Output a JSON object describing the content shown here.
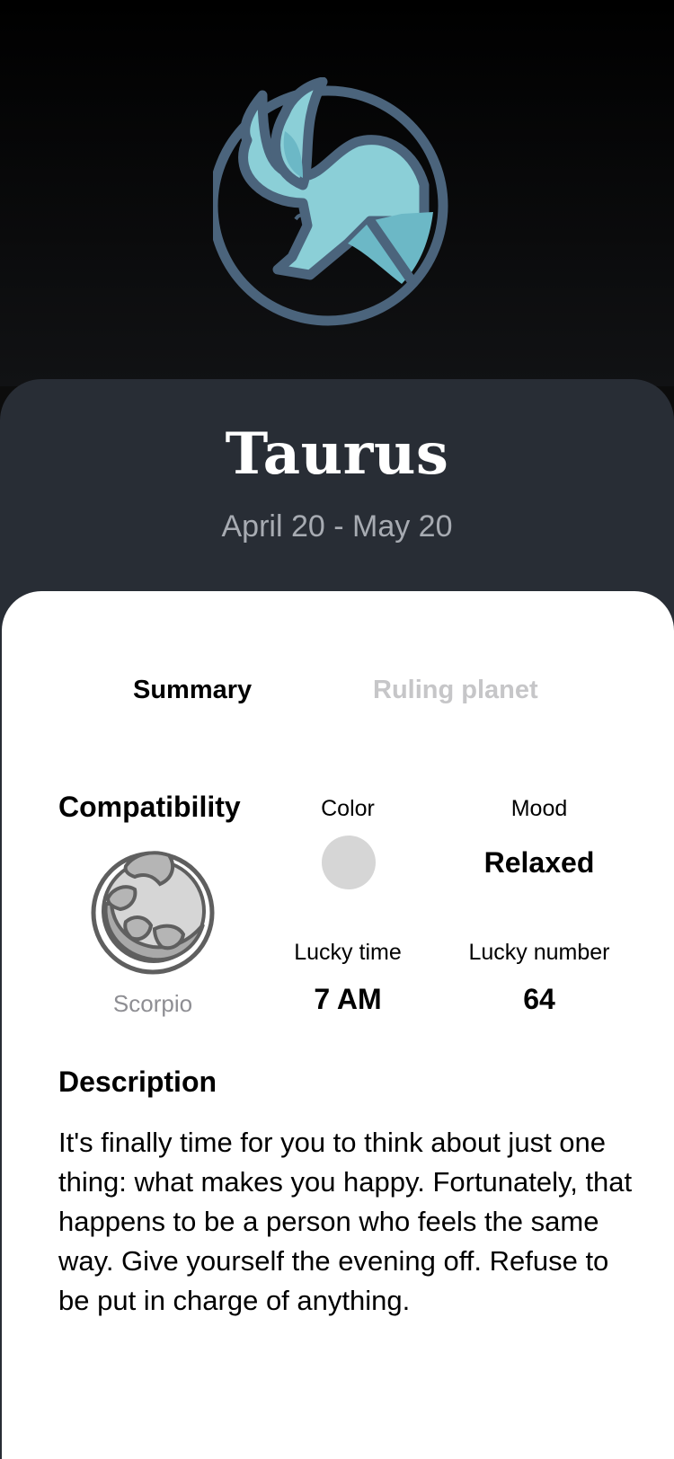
{
  "sign": {
    "icon": "taurus-bull-icon",
    "name": "Taurus",
    "dates": "April 20 - May 20"
  },
  "tabs": [
    {
      "label": "Summary",
      "active": true
    },
    {
      "label": "Ruling planet",
      "active": false
    }
  ],
  "summary": {
    "compatibility": {
      "title": "Compatibility",
      "sign": "Scorpio",
      "icon": "scorpio-icon"
    },
    "color": {
      "label": "Color",
      "value_hex": "#d6d6d6"
    },
    "mood": {
      "label": "Mood",
      "value": "Relaxed"
    },
    "lucky_time": {
      "label": "Lucky time",
      "value": "7 AM"
    },
    "lucky_number": {
      "label": "Lucky number",
      "value": "64"
    }
  },
  "description": {
    "title": "Description",
    "text": "It's finally time for you to think about just one thing: what makes you happy. Fortunately, that happens to be a person who feels the same way. Give yourself the evening off. Refuse to be put in charge of anything."
  },
  "colors": {
    "header_bg": "#282d35",
    "bull_fill": "#8bcfd7",
    "bull_stroke": "#4b647c"
  }
}
